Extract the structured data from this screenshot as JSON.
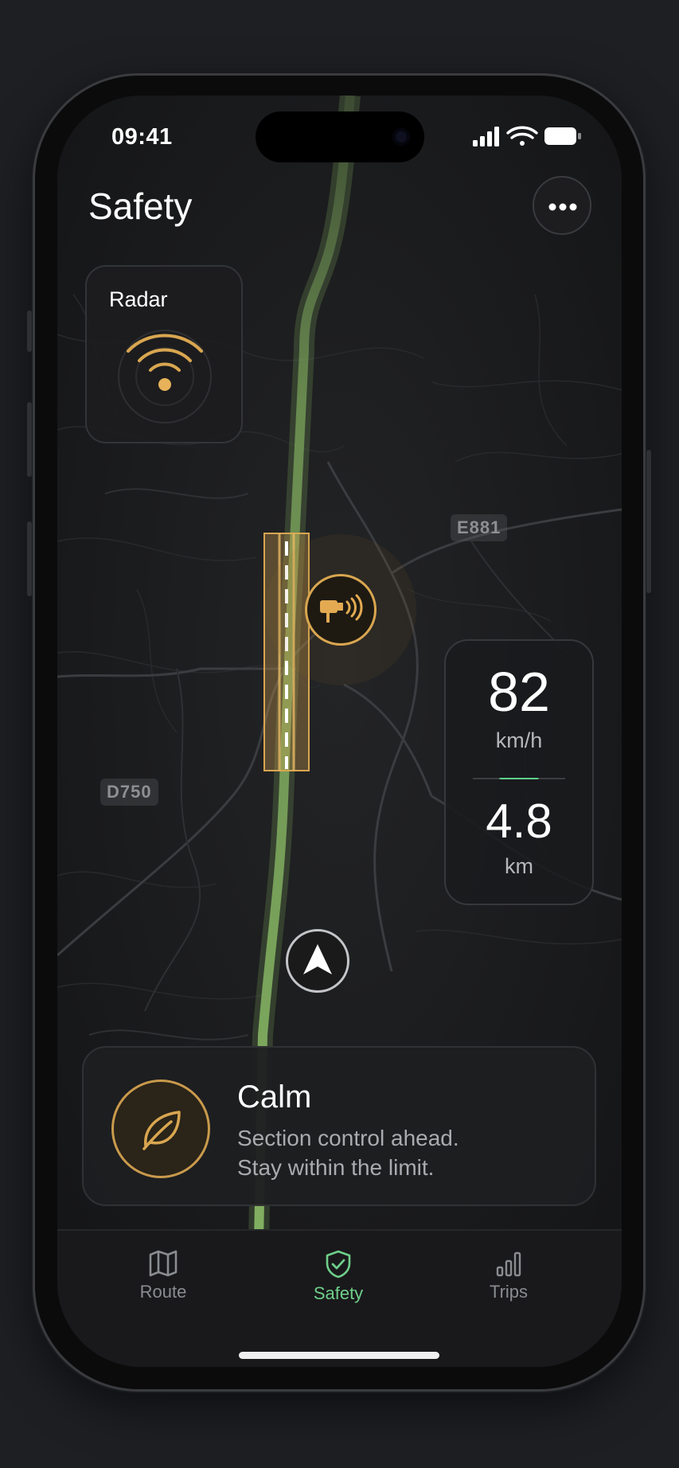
{
  "status_bar": {
    "time": "09:41"
  },
  "header": {
    "title": "Safety"
  },
  "radar": {
    "label": "Radar"
  },
  "map": {
    "road_labels": [
      "E881",
      "D750"
    ]
  },
  "speed_panel": {
    "speed": "82",
    "speed_unit": "km/h",
    "distance": "4.8",
    "distance_unit": "km"
  },
  "alert": {
    "title": "Calm",
    "line1": "Section control ahead.",
    "line2": "Stay within the limit."
  },
  "tabs": [
    {
      "label": "Route",
      "icon": "map-icon"
    },
    {
      "label": "Safety",
      "icon": "shield-check-icon",
      "active": true
    },
    {
      "label": "Trips",
      "icon": "bar-chart-icon"
    }
  ],
  "colors": {
    "accent_green": "#6fcf8a",
    "accent_amber": "#d9a650",
    "route_green": "#7aa35a"
  }
}
